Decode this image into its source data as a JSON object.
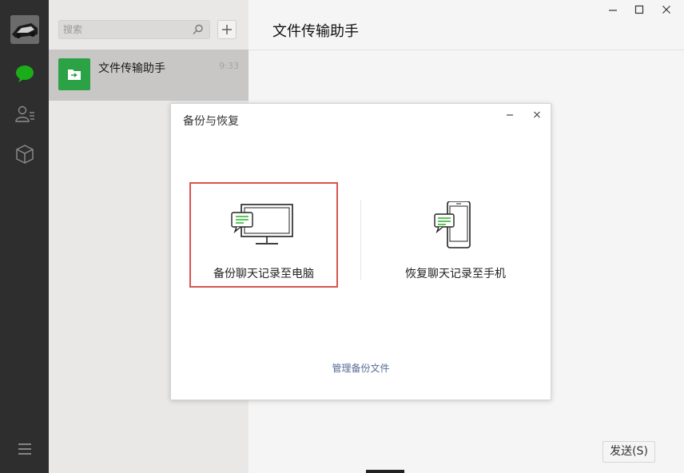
{
  "sidebar": {
    "icons": [
      "avatar",
      "chat-bubble-icon",
      "contacts-icon",
      "favorites-box-icon",
      "menu-icon"
    ],
    "accent_color": "#1aad19"
  },
  "chat_list": {
    "search_placeholder": "搜索",
    "items": [
      {
        "name": "文件传输助手",
        "time": "9:33"
      }
    ]
  },
  "main": {
    "title": "文件传输助手",
    "send_label": "发送(S)"
  },
  "dialog": {
    "title": "备份与恢复",
    "option_backup_label": "备份聊天记录至电脑",
    "option_restore_label": "恢复聊天记录至手机",
    "manage_link": "管理备份文件",
    "highlight_color": "#d9534f"
  }
}
